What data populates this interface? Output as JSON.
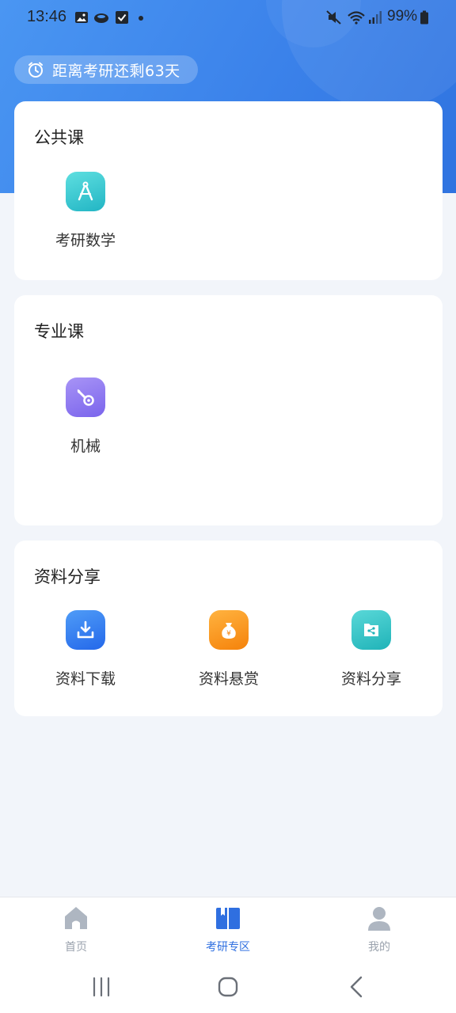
{
  "status_bar": {
    "time": "13:46",
    "battery": "99%",
    "icons": [
      "image-icon",
      "cloud-icon",
      "checkbox-icon",
      "dot-icon",
      "mute-icon",
      "wifi-icon",
      "signal-icon",
      "battery-icon"
    ]
  },
  "countdown": {
    "icon": "alarm-clock-icon",
    "text": "距离考研还剩63天"
  },
  "sections": [
    {
      "title": "公共课",
      "items": [
        {
          "label": "考研数学",
          "icon": "compass-icon",
          "color": "#2fc6cc"
        }
      ]
    },
    {
      "title": "专业课",
      "items": [
        {
          "label": "机械",
          "icon": "wrench-gear-icon",
          "color": "#8a76f0"
        }
      ]
    },
    {
      "title": "资料分享",
      "items": [
        {
          "label": "资料下载",
          "icon": "download-icon",
          "color": "#2f7cf0"
        },
        {
          "label": "资料悬赏",
          "icon": "money-bag-icon",
          "color": "#fb9518"
        },
        {
          "label": "资料分享",
          "icon": "folder-share-icon",
          "color": "#2ec4c6"
        }
      ]
    }
  ],
  "tab_bar": [
    {
      "label": "首页",
      "icon": "home-icon",
      "active": false
    },
    {
      "label": "考研专区",
      "icon": "book-icon",
      "active": true
    },
    {
      "label": "我的",
      "icon": "user-icon",
      "active": false
    }
  ],
  "nav_bar": [
    "recents-button",
    "home-button",
    "back-button"
  ],
  "colors": {
    "header_blue": "#3b82ea",
    "active_tab": "#2f6fe0",
    "inactive_tab": "#9aa2ad",
    "background": "#f2f5fa"
  }
}
